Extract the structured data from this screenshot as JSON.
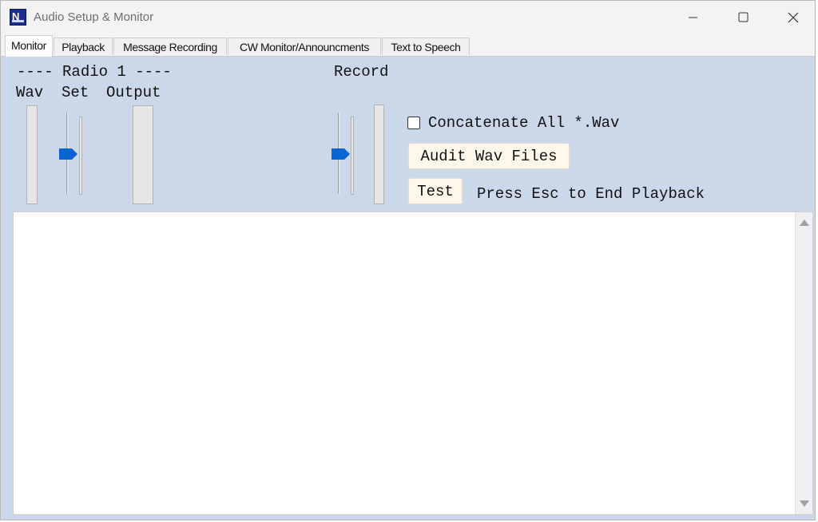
{
  "window": {
    "title": "Audio Setup & Monitor",
    "icon": "nm-logo-icon",
    "controls": [
      "minimize-icon",
      "maximize-icon",
      "close-icon"
    ]
  },
  "tabs": [
    {
      "label": "Monitor",
      "active": true
    },
    {
      "label": "Playback",
      "active": false
    },
    {
      "label": "Message Recording",
      "active": false
    },
    {
      "label": "CW Monitor/Announcments",
      "active": false
    },
    {
      "label": "Text to Speech",
      "active": false
    }
  ],
  "monitor": {
    "radio_header": "---- Radio 1 ----",
    "wav_label": "Wav",
    "set_label": "Set",
    "output_label": "Output",
    "record_label": "Record",
    "concatenate": {
      "label": "Concatenate All *.Wav",
      "checked": false
    },
    "audit_button": "Audit Wav Files",
    "test_button": "Test",
    "hint": "Press Esc to End Playback"
  },
  "colors": {
    "panel_bg": "#cad8e9",
    "slider_thumb": "#0a64d2",
    "button_bg": "#fff8ea"
  }
}
